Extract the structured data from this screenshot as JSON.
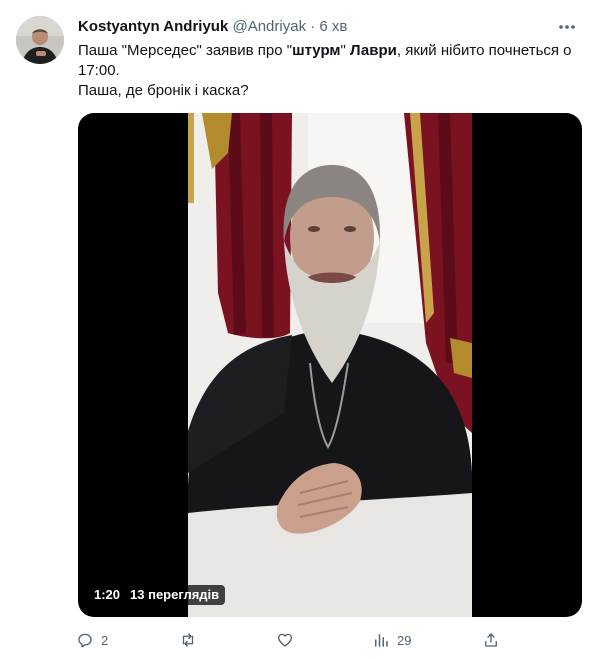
{
  "author": {
    "name": "Kostyantyn Andriyuk",
    "handle": "@Andriyak",
    "separator": "·",
    "time": "6 хв"
  },
  "tweet": {
    "line1_a": "Паша \"Мерседес\" заявив про \"",
    "line1_b": "штурм",
    "line1_c": "\" ",
    "line1_d": "Лаври",
    "line1_e": ", який нібито почнеться о 17:00.",
    "line2": "Паша, де бронік і каска?"
  },
  "video": {
    "duration": "1:20",
    "views": "13 переглядів"
  },
  "actions": {
    "replies": "2",
    "retweets": "",
    "likes": "",
    "views": "29"
  },
  "icons": [
    "more-icon",
    "reply-icon",
    "retweet-icon",
    "like-icon",
    "views-icon",
    "share-icon"
  ],
  "colors": {
    "text": "#0f1419",
    "secondary": "#536471"
  }
}
